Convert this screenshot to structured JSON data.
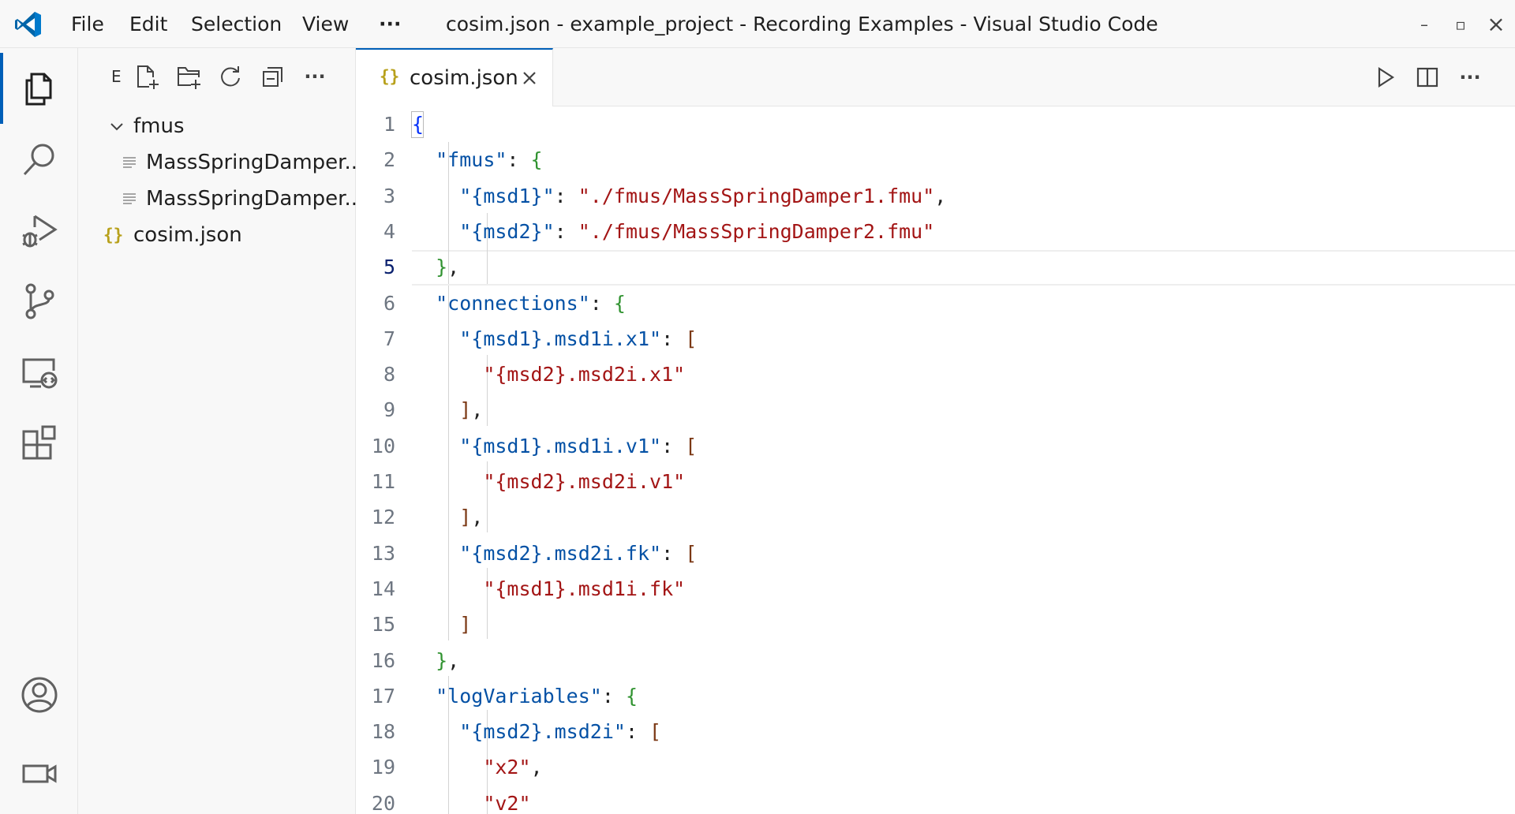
{
  "window": {
    "title": "cosim.json - example_project - Recording Examples - Visual Studio Code",
    "menu": [
      "File",
      "Edit",
      "Selection",
      "View",
      "···"
    ],
    "controls": {
      "minimize": "–",
      "restore": "▫",
      "close": "×"
    }
  },
  "activity_bar": {
    "items": [
      {
        "name": "explorer",
        "icon": "files-icon",
        "active": true
      },
      {
        "name": "search",
        "icon": "search-icon"
      },
      {
        "name": "run-and-debug",
        "icon": "run-debug-icon"
      },
      {
        "name": "source-control",
        "icon": "source-control-icon"
      },
      {
        "name": "remote-explorer",
        "icon": "remote-explorer-icon"
      },
      {
        "name": "extensions",
        "icon": "extensions-icon"
      },
      {
        "name": "accounts",
        "icon": "account-icon"
      },
      {
        "name": "recording",
        "icon": "video-camera-icon"
      }
    ]
  },
  "sidebar": {
    "title": "E",
    "actions": [
      "new-file-icon",
      "new-folder-icon",
      "refresh-icon",
      "collapse-all-icon",
      "more-icon"
    ],
    "more_label": "···",
    "tree": [
      {
        "type": "folder",
        "label": "fmus",
        "expanded": true
      },
      {
        "type": "file",
        "label": "MassSpringDamper...",
        "indent": 1
      },
      {
        "type": "file",
        "label": "MassSpringDamper...",
        "indent": 1
      },
      {
        "type": "json",
        "label": "cosim.json",
        "indent": 0
      }
    ],
    "json_glyph": "{}"
  },
  "editor": {
    "tab": {
      "label": "cosim.json",
      "icon_glyph": "{}"
    },
    "actions": [
      "run-icon",
      "split-editor-icon",
      "more-icon"
    ],
    "more_label": "···",
    "current_line": 5,
    "lines": [
      {
        "n": "1",
        "tokens": [
          [
            "{",
            "b1"
          ]
        ]
      },
      {
        "n": "2",
        "tokens": [
          [
            "  ",
            "p"
          ],
          [
            "\"fmus\"",
            "k"
          ],
          [
            ": ",
            "p"
          ],
          [
            "{",
            "b2"
          ]
        ]
      },
      {
        "n": "3",
        "tokens": [
          [
            "    ",
            "p"
          ],
          [
            "\"{msd1}\"",
            "k"
          ],
          [
            ": ",
            "p"
          ],
          [
            "\"./fmus/MassSpringDamper1.fmu\"",
            "s"
          ],
          [
            ",",
            "p"
          ]
        ]
      },
      {
        "n": "4",
        "tokens": [
          [
            "    ",
            "p"
          ],
          [
            "\"{msd2}\"",
            "k"
          ],
          [
            ": ",
            "p"
          ],
          [
            "\"./fmus/MassSpringDamper2.fmu\"",
            "s"
          ]
        ]
      },
      {
        "n": "5",
        "tokens": [
          [
            "  ",
            "p"
          ],
          [
            "}",
            "b2"
          ],
          [
            ",",
            "p"
          ]
        ]
      },
      {
        "n": "6",
        "tokens": [
          [
            "  ",
            "p"
          ],
          [
            "\"connections\"",
            "k"
          ],
          [
            ": ",
            "p"
          ],
          [
            "{",
            "b2"
          ]
        ]
      },
      {
        "n": "7",
        "tokens": [
          [
            "    ",
            "p"
          ],
          [
            "\"{msd1}.msd1i.x1\"",
            "k"
          ],
          [
            ": ",
            "p"
          ],
          [
            "[",
            "b3"
          ]
        ]
      },
      {
        "n": "8",
        "tokens": [
          [
            "      ",
            "p"
          ],
          [
            "\"{msd2}.msd2i.x1\"",
            "s"
          ]
        ]
      },
      {
        "n": "9",
        "tokens": [
          [
            "    ",
            "p"
          ],
          [
            "]",
            "b3"
          ],
          [
            ",",
            "p"
          ]
        ]
      },
      {
        "n": "10",
        "tokens": [
          [
            "    ",
            "p"
          ],
          [
            "\"{msd1}.msd1i.v1\"",
            "k"
          ],
          [
            ": ",
            "p"
          ],
          [
            "[",
            "b3"
          ]
        ]
      },
      {
        "n": "11",
        "tokens": [
          [
            "      ",
            "p"
          ],
          [
            "\"{msd2}.msd2i.v1\"",
            "s"
          ]
        ]
      },
      {
        "n": "12",
        "tokens": [
          [
            "    ",
            "p"
          ],
          [
            "]",
            "b3"
          ],
          [
            ",",
            "p"
          ]
        ]
      },
      {
        "n": "13",
        "tokens": [
          [
            "    ",
            "p"
          ],
          [
            "\"{msd2}.msd2i.fk\"",
            "k"
          ],
          [
            ": ",
            "p"
          ],
          [
            "[",
            "b3"
          ]
        ]
      },
      {
        "n": "14",
        "tokens": [
          [
            "      ",
            "p"
          ],
          [
            "\"{msd1}.msd1i.fk\"",
            "s"
          ]
        ]
      },
      {
        "n": "15",
        "tokens": [
          [
            "    ",
            "p"
          ],
          [
            "]",
            "b3"
          ]
        ]
      },
      {
        "n": "16",
        "tokens": [
          [
            "  ",
            "p"
          ],
          [
            "}",
            "b2"
          ],
          [
            ",",
            "p"
          ]
        ]
      },
      {
        "n": "17",
        "tokens": [
          [
            "  ",
            "p"
          ],
          [
            "\"logVariables\"",
            "k"
          ],
          [
            ": ",
            "p"
          ],
          [
            "{",
            "b2"
          ]
        ]
      },
      {
        "n": "18",
        "tokens": [
          [
            "    ",
            "p"
          ],
          [
            "\"{msd2}.msd2i\"",
            "k"
          ],
          [
            ": ",
            "p"
          ],
          [
            "[",
            "b3"
          ]
        ]
      },
      {
        "n": "19",
        "tokens": [
          [
            "      ",
            "p"
          ],
          [
            "\"x2\"",
            "s"
          ],
          [
            ",",
            "p"
          ]
        ]
      },
      {
        "n": "20",
        "tokens": [
          [
            "      ",
            "p"
          ],
          [
            "\"v2\"",
            "s"
          ]
        ]
      }
    ]
  },
  "colors": {
    "accent": "#005fb8",
    "json_key": "#0451a5",
    "json_string": "#a31515",
    "json_icon": "#b8a11c"
  }
}
